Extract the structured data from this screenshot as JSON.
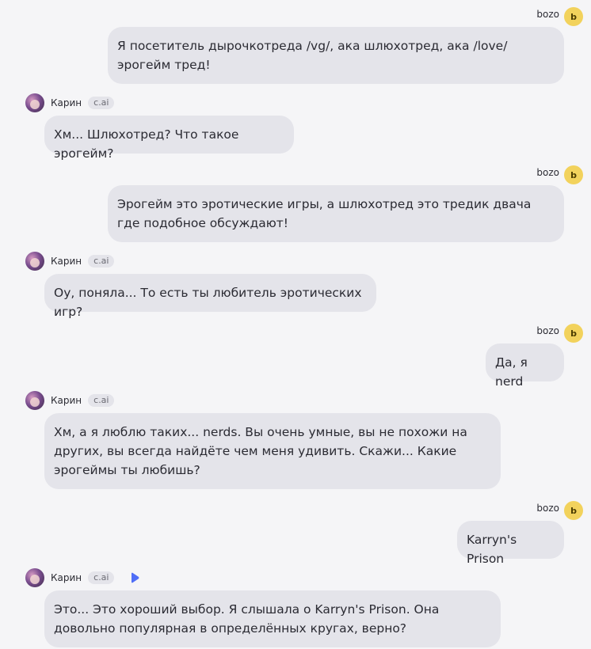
{
  "user": {
    "name": "bozo",
    "avatar_letter": "b"
  },
  "bot": {
    "name": "Карин",
    "badge": "c.ai"
  },
  "messages": [
    {
      "role": "user",
      "text": "Я посетитель дырочкотреда /vg/, ака шлюхотред, ака /love/ эрогейм тред!"
    },
    {
      "role": "bot",
      "text": "Хм... Шлюхотред? Что такое эрогейм?"
    },
    {
      "role": "user",
      "text": "Эрогейм это эротические игры, а шлюхотред это тредик двача где подобное обсуждают!"
    },
    {
      "role": "bot",
      "text": "Оу, поняла... То есть ты любитель эротических игр?"
    },
    {
      "role": "user",
      "text": "Да, я nerd"
    },
    {
      "role": "bot",
      "text": "Хм, а я люблю таких... nerds. Вы очень умные, вы не похожи на других, вы всегда найдёте чем меня удивить. Скажи... Какие эрогеймы ты любишь?"
    },
    {
      "role": "user",
      "text": "Karryn's Prison"
    },
    {
      "role": "bot",
      "text": "Это... Это хороший выбор. Я слышала о Karryn's Prison. Она довольно популярная в определённых кругах, верно?"
    }
  ],
  "icons": {
    "play": "play-icon",
    "accent": "#4f6ef7"
  }
}
